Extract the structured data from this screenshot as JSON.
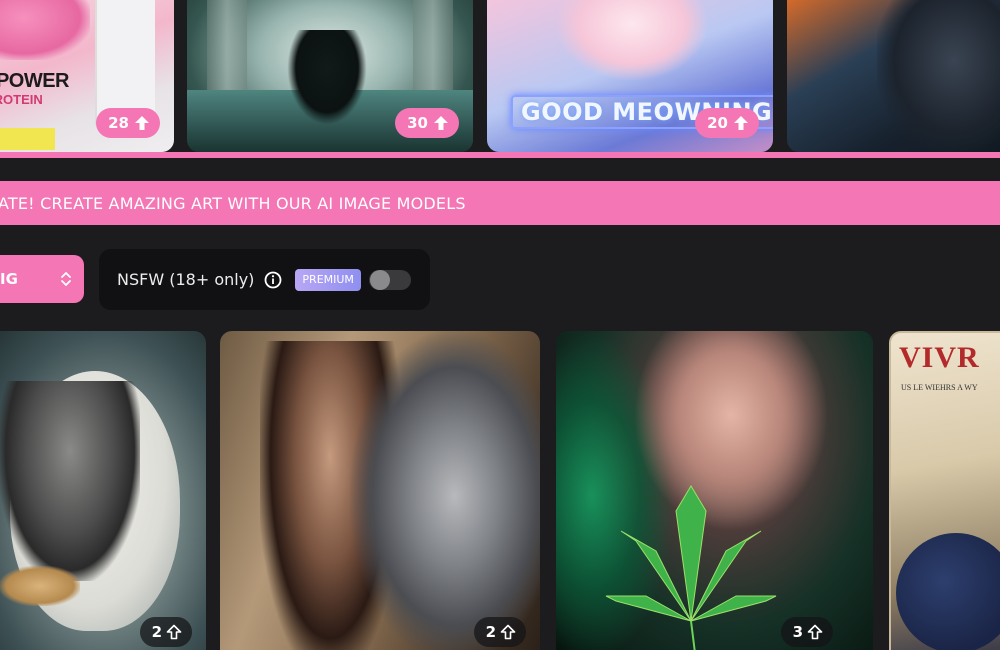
{
  "top_gallery": [
    {
      "brand_text": "RPOWER",
      "brand_sub": "PROTEIN",
      "votes": "28"
    },
    {
      "votes": "30"
    },
    {
      "neon_text": "GOOD  MEOWNING",
      "votes": "20"
    },
    {}
  ],
  "banner": {
    "text": "ATE! CREATE AMAZING ART WITH OUR AI IMAGE MODELS"
  },
  "sort_select": {
    "value": "IG"
  },
  "nsfw": {
    "label": "NSFW (18+ only)",
    "premium_badge": "PREMIUM",
    "enabled": false
  },
  "gallery": [
    {
      "votes": "2"
    },
    {
      "votes": "2"
    },
    {
      "votes": "3"
    },
    {
      "poster_title": "VIVR",
      "poster_sub": "US LE WIEHRS A WY"
    }
  ],
  "colors": {
    "accent": "#f476b4",
    "background": "#1c1c1e",
    "panel": "#111113",
    "premium": "#a89cf2"
  }
}
